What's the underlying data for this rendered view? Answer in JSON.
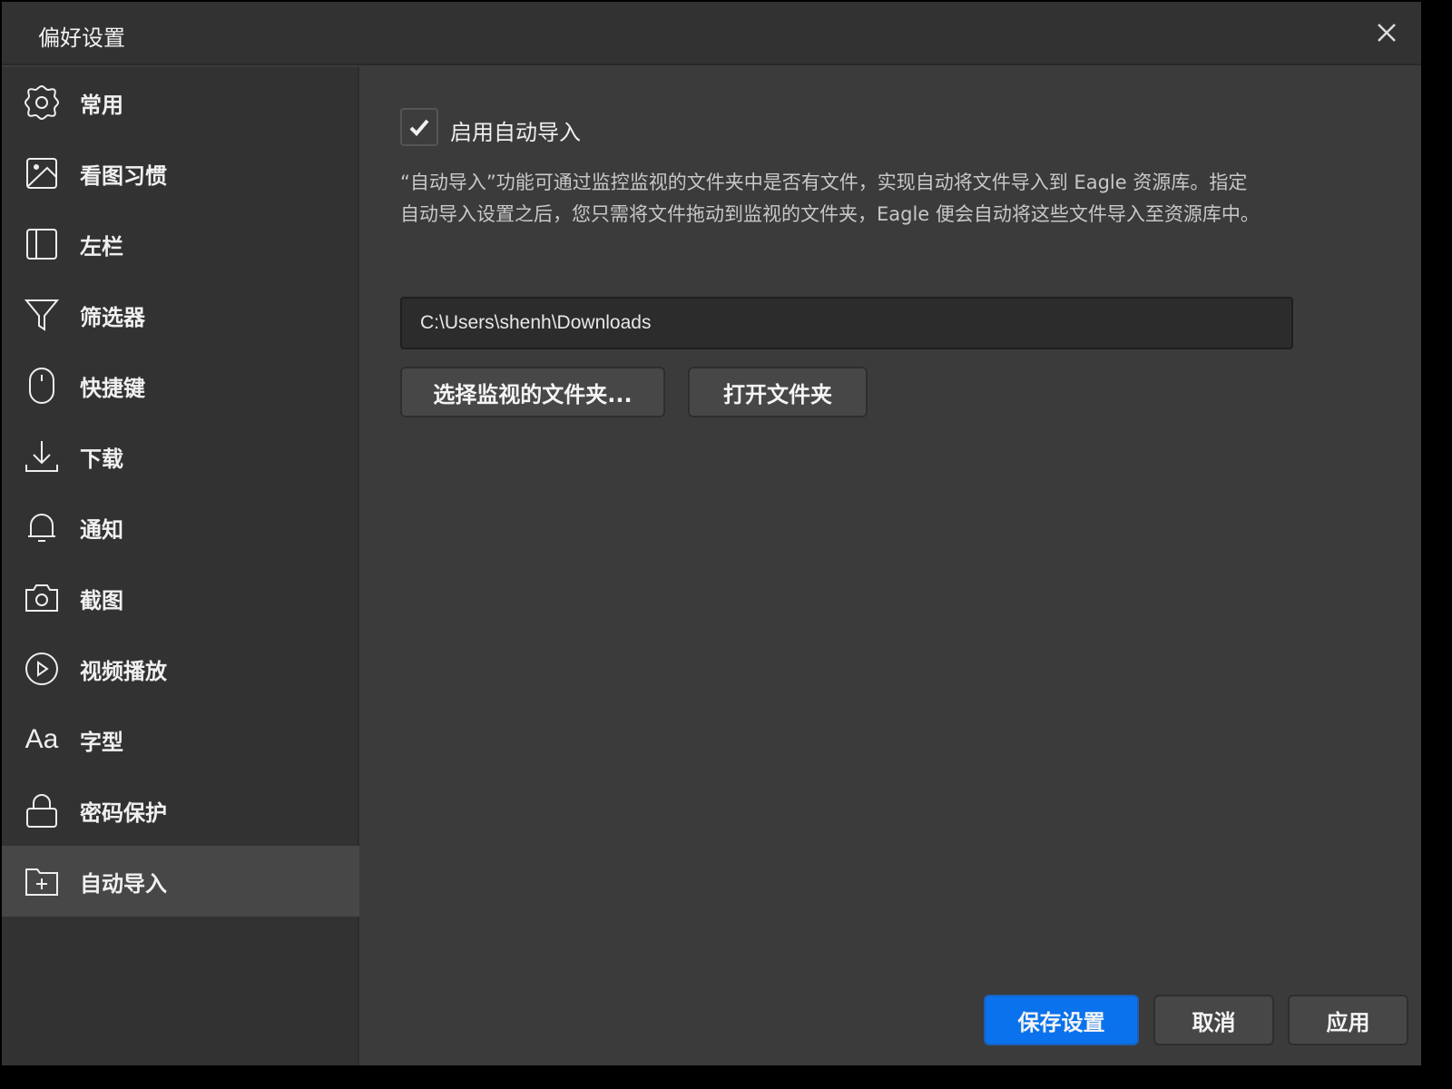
{
  "window": {
    "title": "偏好设置",
    "close_icon": "close-icon"
  },
  "sidebar": {
    "items": [
      {
        "label": "常用",
        "icon": "gear-icon"
      },
      {
        "label": "看图习惯",
        "icon": "image-icon"
      },
      {
        "label": "左栏",
        "icon": "sidebar-layout-icon"
      },
      {
        "label": "筛选器",
        "icon": "filter-icon"
      },
      {
        "label": "快捷键",
        "icon": "mouse-icon"
      },
      {
        "label": "下载",
        "icon": "download-icon"
      },
      {
        "label": "通知",
        "icon": "bell-icon"
      },
      {
        "label": "截图",
        "icon": "camera-icon"
      },
      {
        "label": "视频播放",
        "icon": "play-circle-icon"
      },
      {
        "label": "字型",
        "icon": "font-icon",
        "glyph": "Aa"
      },
      {
        "label": "密码保护",
        "icon": "lock-icon"
      },
      {
        "label": "自动导入",
        "icon": "folder-plus-icon",
        "active": true
      }
    ]
  },
  "main": {
    "enable_label": "启用自动导入",
    "enabled": true,
    "description": "“自动导入”功能可通过监控监视的文件夹中是否有文件，实现自动将文件导入到 Eagle 资源库。指定自动导入设置之后，您只需将文件拖动到监视的文件夹，Eagle 便会自动将这些文件导入至资源库中。",
    "folder_path": "C:\\Users\\shenh\\Downloads",
    "choose_folder_label": "选择监视的文件夹...",
    "open_folder_label": "打开文件夹"
  },
  "footer": {
    "save_label": "保存设置",
    "cancel_label": "取消",
    "apply_label": "应用"
  },
  "colors": {
    "accent": "#0a72ec",
    "background": "#3b3b3b",
    "sidebar": "#323232"
  }
}
